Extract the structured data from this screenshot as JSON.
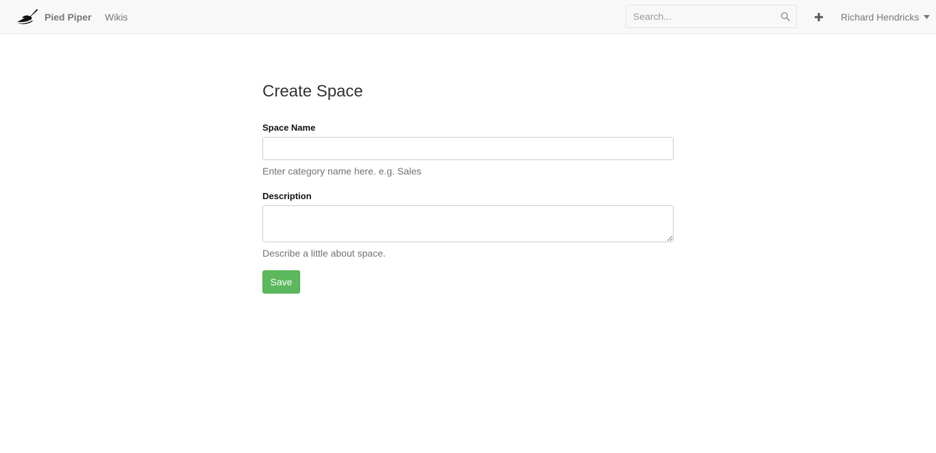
{
  "navbar": {
    "brand_name": "Pied Piper",
    "wikis_label": "Wikis",
    "search_placeholder": "Search...",
    "user_name": "Richard Hendricks",
    "icons": {
      "logo": "pied-piper-logo",
      "search": "search-icon",
      "add": "plus-icon",
      "caret": "caret-down-icon"
    }
  },
  "form": {
    "title": "Create Space",
    "space_name_label": "Space Name",
    "space_name_value": "",
    "space_name_help": "Enter category name here. e.g. Sales",
    "description_label": "Description",
    "description_value": "",
    "description_help": "Describe a little about space.",
    "save_label": "Save"
  },
  "colors": {
    "navbar_bg": "#f8f8f8",
    "primary_success": "#5cb85c",
    "muted_text": "#737373"
  }
}
